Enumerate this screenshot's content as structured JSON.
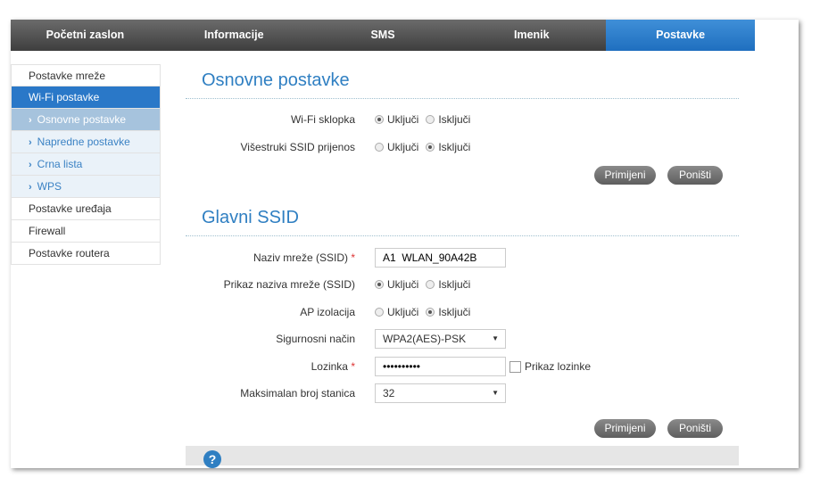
{
  "nav": {
    "tabs": [
      "Početni zaslon",
      "Informacije",
      "SMS",
      "Imenik",
      "Postavke"
    ],
    "active": 4
  },
  "sidebar": {
    "items": [
      {
        "label": "Postavke mreže",
        "type": "main"
      },
      {
        "label": "Wi-Fi postavke",
        "type": "main",
        "active": true
      },
      {
        "label": "Osnovne postavke",
        "type": "sub",
        "active": true
      },
      {
        "label": "Napredne postavke",
        "type": "sub"
      },
      {
        "label": "Crna lista",
        "type": "sub"
      },
      {
        "label": "WPS",
        "type": "sub"
      },
      {
        "label": "Postavke uređaja",
        "type": "main"
      },
      {
        "label": "Firewall",
        "type": "main"
      },
      {
        "label": "Postavke routera",
        "type": "main"
      }
    ]
  },
  "basic": {
    "title": "Osnovne postavke",
    "wifi_switch": {
      "label": "Wi-Fi sklopka",
      "on": "Uključi",
      "off": "Isključi",
      "value": "on"
    },
    "multi_ssid": {
      "label": "Višestruki SSID prijenos",
      "on": "Uključi",
      "off": "Isključi",
      "value": "off"
    },
    "apply": "Primijeni",
    "cancel": "Poništi"
  },
  "ssid": {
    "title": "Glavni SSID",
    "name": {
      "label": "Naziv mreže (SSID)",
      "required": "*",
      "value": "A1  WLAN_90A42B"
    },
    "broadcast": {
      "label": "Prikaz naziva mreže (SSID)",
      "on": "Uključi",
      "off": "Isključi",
      "value": "on"
    },
    "ap_isolation": {
      "label": "AP izolacija",
      "on": "Uključi",
      "off": "Isključi",
      "value": "off"
    },
    "security": {
      "label": "Sigurnosni način",
      "value": "WPA2(AES)-PSK"
    },
    "password": {
      "label": "Lozinka",
      "required": "*",
      "value": "••••••••••",
      "show_label": "Prikaz lozinke"
    },
    "max_stations": {
      "label": "Maksimalan broj stanica",
      "value": "32"
    },
    "apply": "Primijeni",
    "cancel": "Poništi"
  },
  "help": {
    "icon": "?"
  }
}
